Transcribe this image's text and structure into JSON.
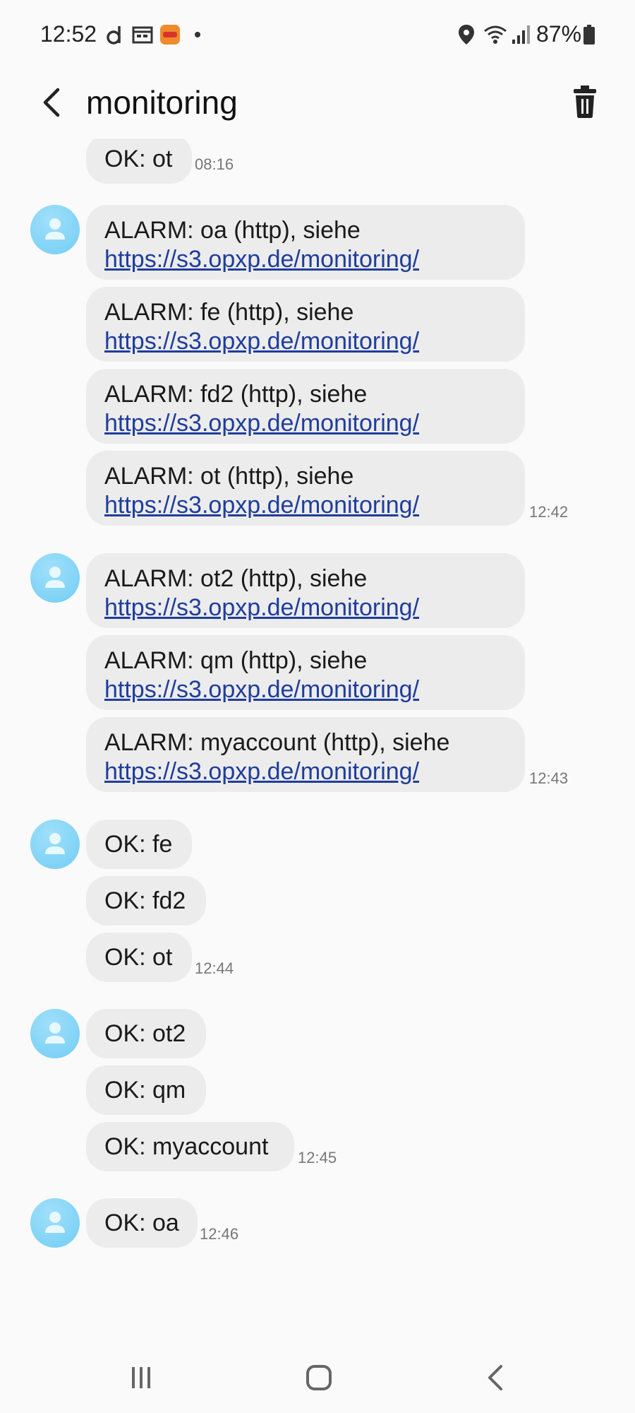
{
  "status_bar": {
    "time": "12:52",
    "battery": "87%"
  },
  "header": {
    "title": "monitoring"
  },
  "messages": [
    {
      "text": "OK: ot",
      "time": "08:16"
    },
    {
      "text": "ALARM: oa (http), siehe",
      "link": "https://s3.opxp.de/monitoring/"
    },
    {
      "text": "ALARM: fe (http), siehe",
      "link": "https://s3.opxp.de/monitoring/"
    },
    {
      "text": "ALARM: fd2 (http), siehe",
      "link": "https://s3.opxp.de/monitoring/"
    },
    {
      "text": "ALARM: ot (http), siehe",
      "link": "https://s3.opxp.de/monitoring/",
      "time": "12:42"
    },
    {
      "text": "ALARM: ot2 (http), siehe",
      "link": "https://s3.opxp.de/monitoring/"
    },
    {
      "text": "ALARM: qm (http), siehe",
      "link": "https://s3.opxp.de/monitoring/"
    },
    {
      "text": "ALARM: myaccount (http), siehe",
      "link": "https://s3.opxp.de/monitoring/",
      "time": "12:43"
    },
    {
      "text": "OK: fe"
    },
    {
      "text": "OK: fd2"
    },
    {
      "text": "OK: ot",
      "time": "12:44"
    },
    {
      "text": "OK: ot2"
    },
    {
      "text": "OK: qm"
    },
    {
      "text": "OK: myaccount",
      "time": "12:45"
    },
    {
      "text": "OK: oa",
      "time": "12:46"
    }
  ],
  "colors": {
    "bubble": "#ececec",
    "link": "#1f3d9c",
    "avatar": "#7fd3f5"
  },
  "icons": {
    "back": "chevron-left-icon",
    "delete": "trash-icon",
    "avatar": "person-icon"
  }
}
